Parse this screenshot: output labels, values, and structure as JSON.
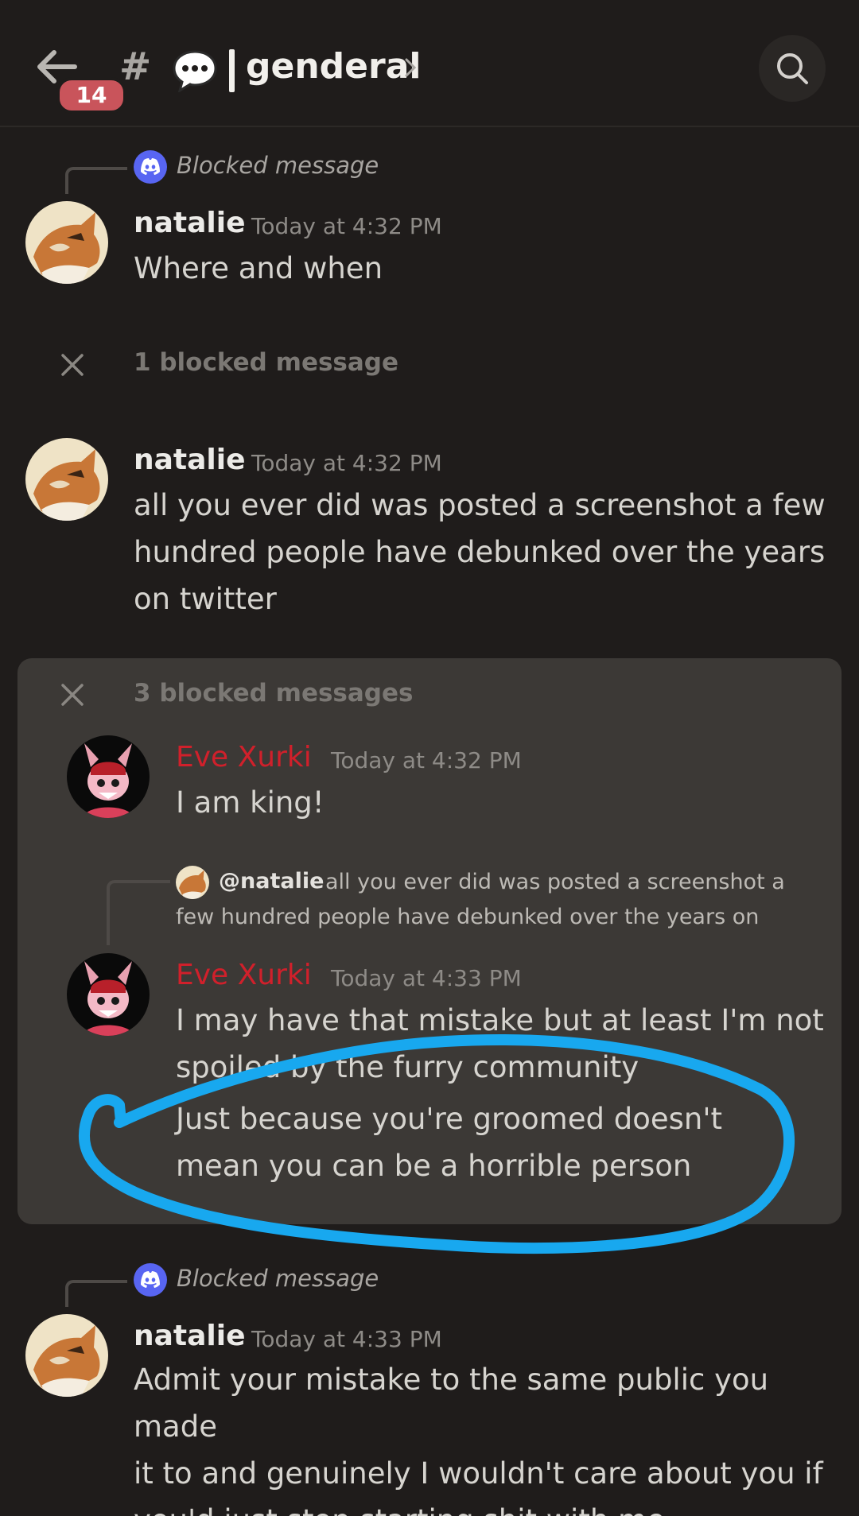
{
  "header": {
    "unread_count": "14",
    "hash": "#",
    "channel_name": "genderal",
    "channel_emoji": "speech-balloon-icon"
  },
  "messages": [
    {
      "reply_to": "Blocked message",
      "author": "natalie",
      "time": "Today at 4:32 PM",
      "text": "Where and when"
    },
    {
      "blocked_label": "1 blocked message"
    },
    {
      "author": "natalie",
      "time": "Today at 4:32 PM",
      "text": "all you ever did was posted a screenshot a few\nhundred people have debunked over the years\non twitter"
    },
    {
      "blocked_label": "3 blocked messages",
      "items": [
        {
          "author": "Eve Xurki",
          "time": "Today at 4:32 PM",
          "text": "I am king!"
        },
        {
          "reply_mention": "@natalie",
          "reply_preview_line1": "all you ever did was posted a screenshot a",
          "reply_preview_line2": "few hundred people have debunked over the years on",
          "author": "Eve Xurki",
          "time": "Today at 4:33 PM",
          "text": "I may have that mistake but at least I'm not\nspoiled by the furry community",
          "text2": "Just because you're groomed doesn't\nmean you can be a horrible person"
        }
      ]
    },
    {
      "reply_to": "Blocked message",
      "author": "natalie",
      "time": "Today at 4:33 PM",
      "text": "Admit your mistake to the same public you made\nit to and genuinely I wouldn't care about you if\nyou'd just stop starting shit with me"
    }
  ],
  "colors": {
    "background": "#1f1c1b",
    "blocked_panel": "#3c3936",
    "badge": "#c9545b",
    "eve_name": "#d0202b",
    "annotation": "#18a8ef",
    "discord_blurple": "#5865f2"
  }
}
